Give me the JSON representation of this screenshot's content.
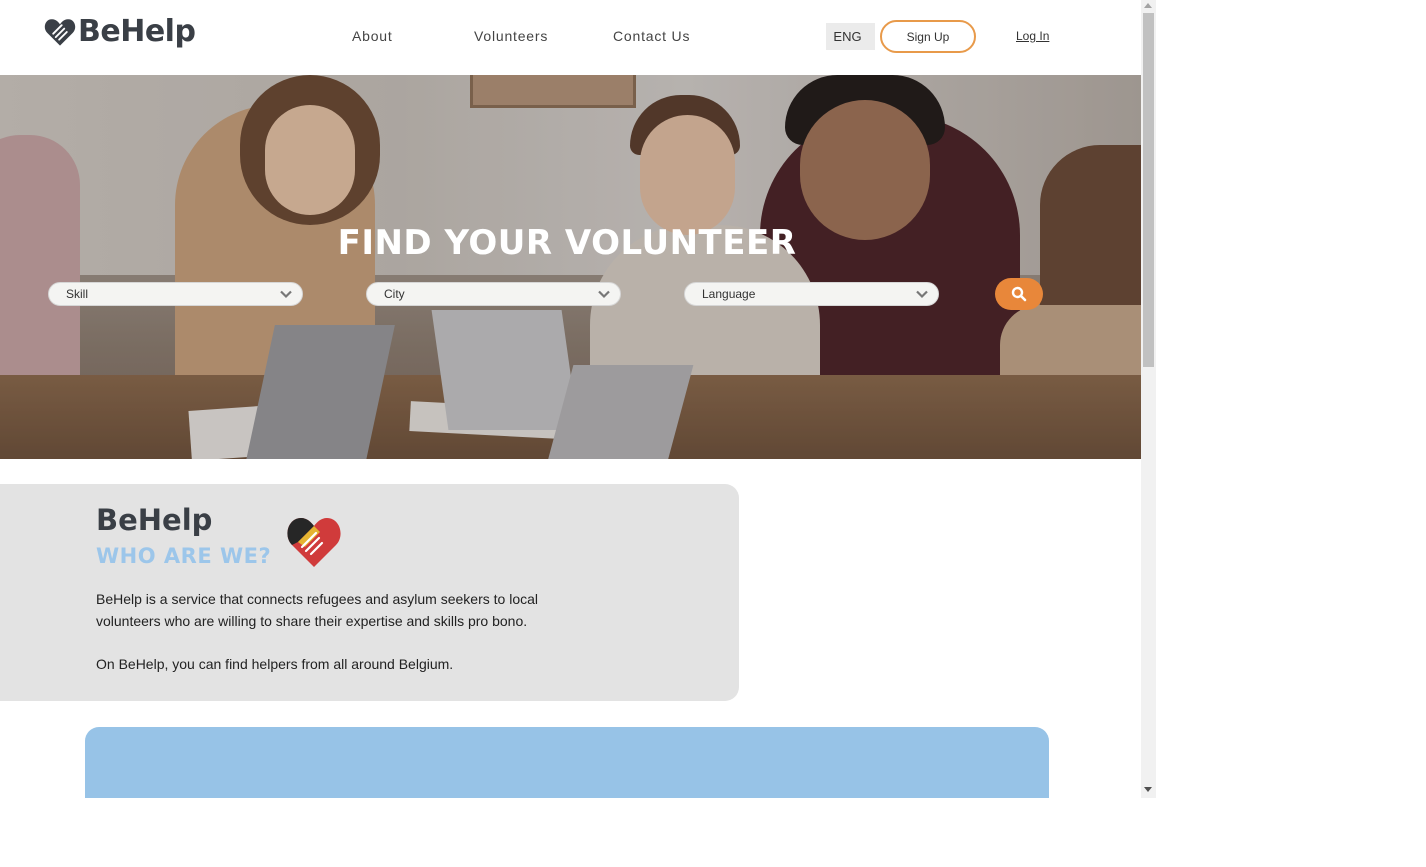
{
  "header": {
    "brand": "BeHelp",
    "nav": [
      {
        "label": "About"
      },
      {
        "label": "Volunteers"
      },
      {
        "label": "Contact Us"
      }
    ],
    "language": "ENG",
    "signup_label": "Sign Up",
    "login_label": "Log In"
  },
  "hero": {
    "title": "FIND YOUR VOLUNTEER",
    "filters": [
      {
        "value": "Skill"
      },
      {
        "value": "City"
      },
      {
        "value": "Language"
      }
    ]
  },
  "about": {
    "title": "BeHelp",
    "subtitle": "WHO ARE WE?",
    "paragraph1_line1": "BeHelp is a service that connects refugees and asylum seekers to local",
    "paragraph1_line2": "volunteers who are willing to share their expertise and skills pro bono.",
    "paragraph2": "On BeHelp, you can find helpers from all around Belgium."
  },
  "colors": {
    "accent": "#e8873a",
    "subtitle_blue": "#9cc6ea",
    "card_gray": "#e3e3e3",
    "block_blue": "#97c3e7",
    "brand_dark": "#3a3f46"
  },
  "icons": {
    "logo": "heart-hands-icon",
    "search": "search-icon",
    "chevron": "chevron-down-icon"
  }
}
